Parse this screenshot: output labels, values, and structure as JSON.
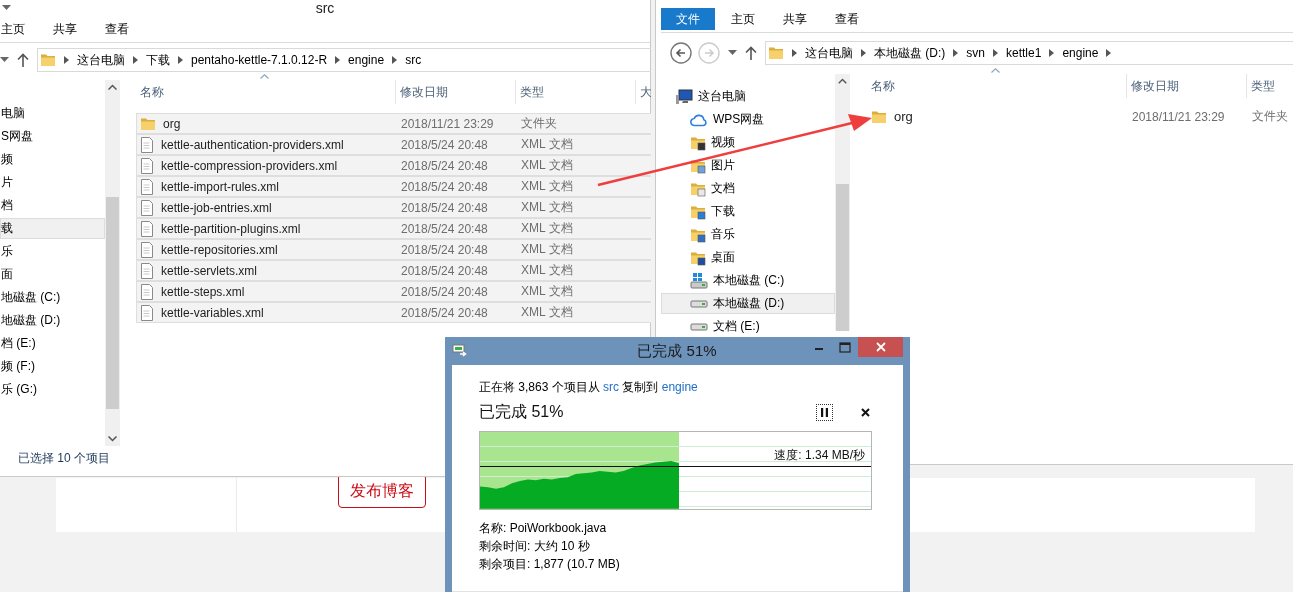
{
  "blog_page": {
    "publish_button": "发布博客"
  },
  "left_window": {
    "title": "src",
    "ribbon_tabs": [
      {
        "label": "主页",
        "kind": "tab",
        "selected": false
      },
      {
        "label": "共享",
        "kind": "tab",
        "selected": false
      },
      {
        "label": "查看",
        "kind": "tab",
        "selected": false
      }
    ],
    "nav_buttons": [
      {
        "kind": "history",
        "disabled": false
      },
      {
        "kind": "up",
        "disabled": false
      }
    ],
    "breadcrumb": {
      "items": [
        "这台电脑",
        "下载",
        "pentaho-kettle-7.1.0.12-R",
        "engine",
        "src"
      ]
    },
    "nav_items": [
      {
        "label": "电脑",
        "selected": false
      },
      {
        "label": "S网盘",
        "selected": false
      },
      {
        "label": "频",
        "selected": false
      },
      {
        "label": "片",
        "selected": false
      },
      {
        "label": "档",
        "selected": false
      },
      {
        "label": "载",
        "selected": true
      },
      {
        "label": "乐",
        "selected": false
      },
      {
        "label": "面",
        "selected": false
      },
      {
        "label": "地磁盘 (C:)",
        "selected": false
      },
      {
        "label": "地磁盘 (D:)",
        "selected": false
      },
      {
        "label": "档 (E:)",
        "selected": false
      },
      {
        "label": "频 (F:)",
        "selected": false
      },
      {
        "label": "乐 (G:)",
        "selected": false
      }
    ],
    "columns": [
      "名称",
      "修改日期",
      "类型",
      "大"
    ],
    "files": [
      {
        "name": "org",
        "kind": "folder",
        "modified": "2018/11/21 23:29",
        "type": "文件夹",
        "selected": true
      },
      {
        "name": "kettle-authentication-providers.xml",
        "kind": "file",
        "modified": "2018/5/24 20:48",
        "type": "XML 文档",
        "selected": true
      },
      {
        "name": "kettle-compression-providers.xml",
        "kind": "file",
        "modified": "2018/5/24 20:48",
        "type": "XML 文档",
        "selected": true
      },
      {
        "name": "kettle-import-rules.xml",
        "kind": "file",
        "modified": "2018/5/24 20:48",
        "type": "XML 文档",
        "selected": true
      },
      {
        "name": "kettle-job-entries.xml",
        "kind": "file",
        "modified": "2018/5/24 20:48",
        "type": "XML 文档",
        "selected": true
      },
      {
        "name": "kettle-partition-plugins.xml",
        "kind": "file",
        "modified": "2018/5/24 20:48",
        "type": "XML 文档",
        "selected": true
      },
      {
        "name": "kettle-repositories.xml",
        "kind": "file",
        "modified": "2018/5/24 20:48",
        "type": "XML 文档",
        "selected": true
      },
      {
        "name": "kettle-servlets.xml",
        "kind": "file",
        "modified": "2018/5/24 20:48",
        "type": "XML 文档",
        "selected": true
      },
      {
        "name": "kettle-steps.xml",
        "kind": "file",
        "modified": "2018/5/24 20:48",
        "type": "XML 文档",
        "selected": true
      },
      {
        "name": "kettle-variables.xml",
        "kind": "file",
        "modified": "2018/5/24 20:48",
        "type": "XML 文档",
        "selected": true
      }
    ],
    "status": "已选择 10 个项目"
  },
  "right_window": {
    "ribbon_tabs": [
      {
        "label": "文件",
        "kind": "file-menu",
        "selected": false
      },
      {
        "label": "主页",
        "kind": "tab",
        "selected": false
      },
      {
        "label": "共享",
        "kind": "tab",
        "selected": false
      },
      {
        "label": "查看",
        "kind": "tab",
        "selected": false
      }
    ],
    "nav_buttons": [
      {
        "kind": "back",
        "disabled": false
      },
      {
        "kind": "forward",
        "disabled": true
      },
      {
        "kind": "history",
        "disabled": false
      },
      {
        "kind": "up",
        "disabled": false
      }
    ],
    "breadcrumb": {
      "items": [
        "这台电脑",
        "本地磁盘 (D:)",
        "svn",
        "kettle1",
        "engine"
      ],
      "trailing_separator": true
    },
    "nav_items": [
      {
        "label": "这台电脑",
        "kind": "computer",
        "selected": false,
        "children": [
          {
            "label": "WPS网盘",
            "kind": "cloud",
            "selected": false
          },
          {
            "label": "视频",
            "kind": "videos",
            "selected": false
          },
          {
            "label": "图片",
            "kind": "pictures",
            "selected": false
          },
          {
            "label": "文档",
            "kind": "documents",
            "selected": false
          },
          {
            "label": "下载",
            "kind": "downloads",
            "selected": false
          },
          {
            "label": "音乐",
            "kind": "music",
            "selected": false
          },
          {
            "label": "桌面",
            "kind": "desktop",
            "selected": false
          },
          {
            "label": "本地磁盘 (C:)",
            "kind": "system-drive",
            "selected": false
          },
          {
            "label": "本地磁盘 (D:)",
            "kind": "drive",
            "selected": true
          },
          {
            "label": "文档 (E:)",
            "kind": "drive",
            "selected": false
          }
        ]
      }
    ],
    "columns": [
      "名称",
      "修改日期",
      "类型"
    ],
    "files": [
      {
        "name": "org",
        "kind": "folder",
        "modified": "2018/11/21 23:29",
        "type": "文件夹",
        "selected": false
      }
    ]
  },
  "copy_dialog": {
    "title": "已完成 51%",
    "summary": [
      {
        "kind": "text",
        "text": "正在将 3,863 个项目从 "
      },
      {
        "kind": "link",
        "text": "src"
      },
      {
        "kind": "text",
        "text": " 复制到 "
      },
      {
        "kind": "link",
        "text": "engine"
      }
    ],
    "heading": "已完成 51%",
    "level": 0.51,
    "speed": "速度: 1.34 MB/秒",
    "details": [
      "名称: PoiWorkbook.java",
      "剩余时间: 大约 10 秒",
      "剩余项目: 1,877 (10.7 MB)"
    ]
  }
}
